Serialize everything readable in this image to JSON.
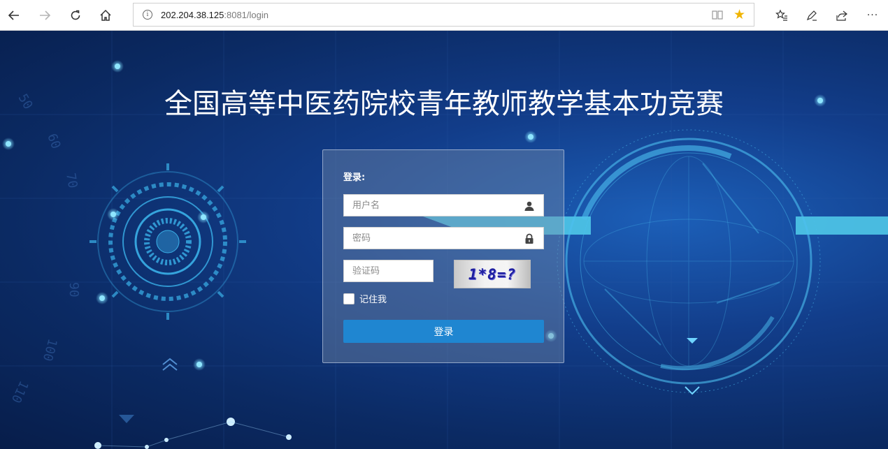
{
  "browser": {
    "url_host": "202.204.38.125",
    "url_rest": ":8081/login",
    "nav_icons": {
      "back": "back-arrow-icon",
      "forward": "forward-arrow-icon",
      "refresh": "refresh-icon",
      "home": "home-icon"
    },
    "tool_icons": [
      "favorites-icon",
      "pen-icon",
      "share-icon",
      "more-icon"
    ],
    "more_label": "···"
  },
  "page": {
    "title": "全国高等中医药院校青年教师教学基本功竞赛"
  },
  "login": {
    "heading": "登录:",
    "username_placeholder": "用户名",
    "password_placeholder": "密码",
    "captcha_placeholder": "验证码",
    "captcha_text": "1*8=?",
    "remember_label": "记住我",
    "submit_label": "登录",
    "accent_color": "#1f86d1"
  }
}
